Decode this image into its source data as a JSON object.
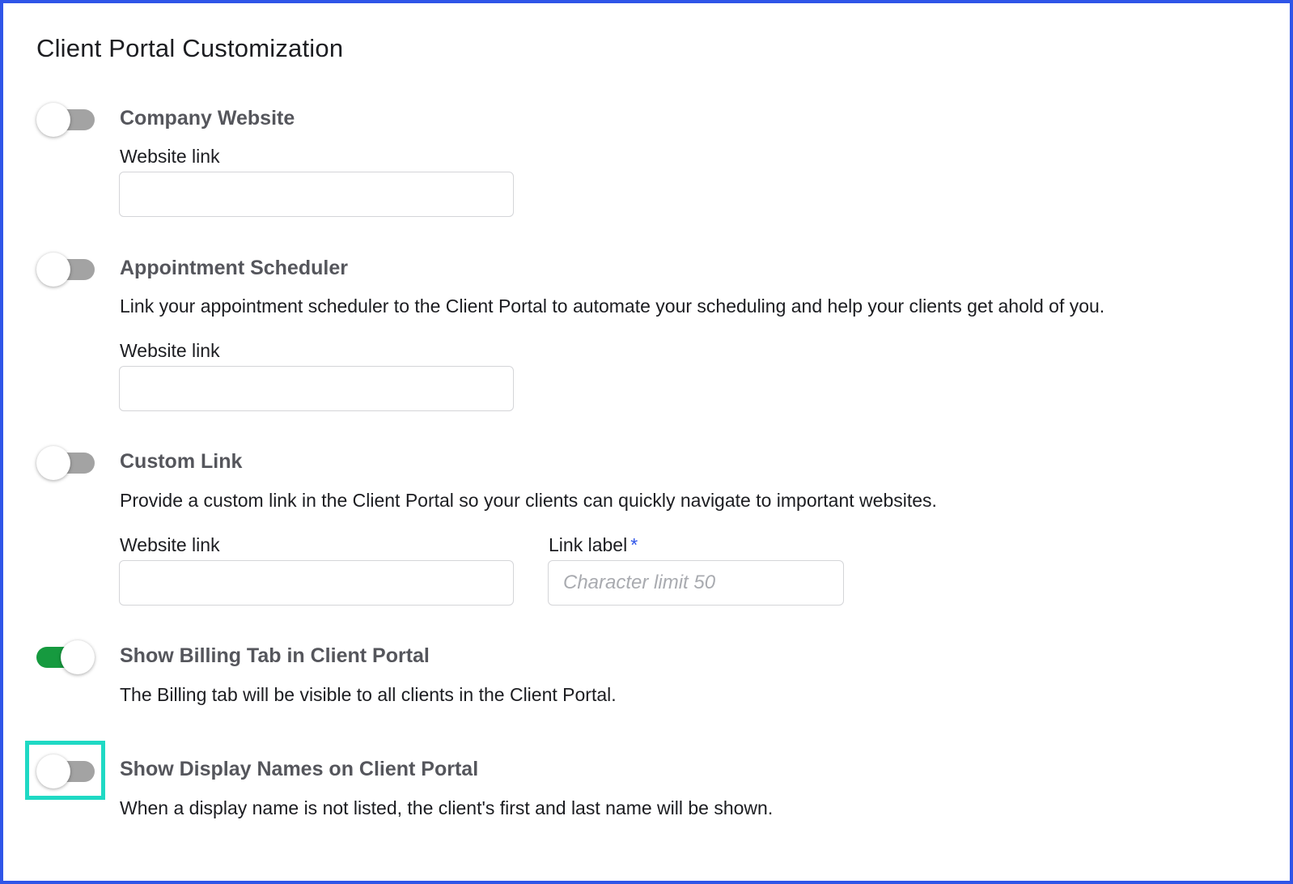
{
  "page": {
    "title": "Client Portal Customization"
  },
  "sections": {
    "company_website": {
      "title": "Company Website",
      "toggle_on": false,
      "field_label": "Website link",
      "field_value": ""
    },
    "appointment_scheduler": {
      "title": "Appointment Scheduler",
      "description": "Link your appointment scheduler to the Client Portal to automate your scheduling and help your clients get ahold of you.",
      "toggle_on": false,
      "field_label": "Website link",
      "field_value": ""
    },
    "custom_link": {
      "title": "Custom Link",
      "description": "Provide a custom link in the Client Portal so your clients can quickly navigate to important websites.",
      "toggle_on": false,
      "website_label": "Website link",
      "website_value": "",
      "link_label": "Link label",
      "link_label_required_mark": "*",
      "link_label_placeholder": "Character limit 50",
      "link_label_value": ""
    },
    "billing_tab": {
      "title": "Show Billing Tab in Client Portal",
      "description": "The Billing tab will be visible to all clients in the Client Portal.",
      "toggle_on": true
    },
    "display_names": {
      "title": "Show Display Names on Client Portal",
      "description": "When a display name is not listed, the client's first and last name will be shown.",
      "toggle_on": false,
      "highlighted": true
    }
  },
  "colors": {
    "frame_border": "#2f55e8",
    "toggle_on": "#169a3f",
    "toggle_off": "#a3a3a3",
    "highlight": "#1fd9c4",
    "required_mark": "#2f55e8"
  }
}
